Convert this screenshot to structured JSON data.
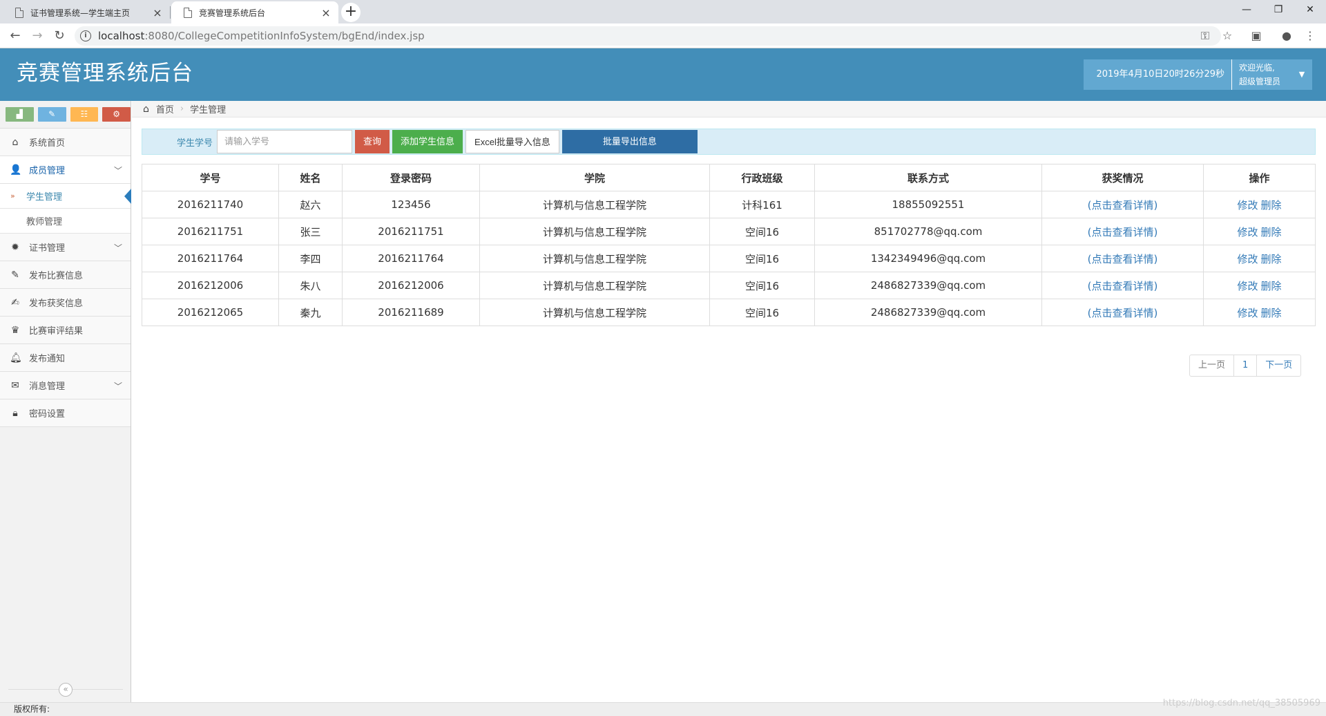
{
  "browser": {
    "tabs": [
      {
        "title": "证书管理系统—学生端主页",
        "close": "×"
      },
      {
        "title": "竞赛管理系统后台",
        "close": "×"
      }
    ],
    "new_tab": "+",
    "url_host": "localhost",
    "url_rest": ":8080/CollegeCompetitionInfoSystem/bgEnd/index.jsp",
    "controls": {
      "minimize": "—",
      "maximize": "❐",
      "close": "✕"
    }
  },
  "header": {
    "title": "竞赛管理系统后台",
    "datetime": "2019年4月10日20时26分29秒",
    "welcome": "欢迎光临,",
    "role": "超级管理员"
  },
  "sidebar": {
    "items": [
      {
        "label": "系统首页",
        "icon": "home-icon"
      },
      {
        "label": "成员管理",
        "icon": "users-icon",
        "open": true
      },
      {
        "label": "证书管理",
        "icon": "cog-icon"
      },
      {
        "label": "发布比赛信息",
        "icon": "pencil-icon"
      },
      {
        "label": "发布获奖信息",
        "icon": "edit-icon"
      },
      {
        "label": "比赛审评结果",
        "icon": "trophy-icon"
      },
      {
        "label": "发布通知",
        "icon": "bell-icon"
      },
      {
        "label": "消息管理",
        "icon": "envelope-icon"
      },
      {
        "label": "密码设置",
        "icon": "lock-icon"
      }
    ],
    "subitems": [
      {
        "label": "学生管理",
        "active": true
      },
      {
        "label": "教师管理"
      }
    ]
  },
  "breadcrumb": {
    "home": "首页",
    "current": "学生管理"
  },
  "search": {
    "label": "学生学号",
    "placeholder": "请输入学号",
    "query_btn": "查询",
    "add_btn": "添加学生信息",
    "import_btn": "Excel批量导入信息",
    "export_btn": "批量导出信息"
  },
  "table": {
    "headers": [
      "学号",
      "姓名",
      "登录密码",
      "学院",
      "行政班级",
      "联系方式",
      "获奖情况",
      "操作"
    ],
    "rows": [
      {
        "id": "2016211740",
        "name": "赵六",
        "password": "123456",
        "college": "计算机与信息工程学院",
        "class": "计科161",
        "contact": "18855092551",
        "award": "(点击查看详情)",
        "edit": "修改",
        "delete": "删除"
      },
      {
        "id": "2016211751",
        "name": "张三",
        "password": "2016211751",
        "college": "计算机与信息工程学院",
        "class": "空间16",
        "contact": "851702778@qq.com",
        "award": "(点击查看详情)",
        "edit": "修改",
        "delete": "删除"
      },
      {
        "id": "2016211764",
        "name": "李四",
        "password": "2016211764",
        "college": "计算机与信息工程学院",
        "class": "空间16",
        "contact": "1342349496@qq.com",
        "award": "(点击查看详情)",
        "edit": "修改",
        "delete": "删除"
      },
      {
        "id": "2016212006",
        "name": "朱八",
        "password": "2016212006",
        "college": "计算机与信息工程学院",
        "class": "空间16",
        "contact": "2486827339@qq.com",
        "award": "(点击查看详情)",
        "edit": "修改",
        "delete": "删除"
      },
      {
        "id": "2016212065",
        "name": "秦九",
        "password": "2016211689",
        "college": "计算机与信息工程学院",
        "class": "空间16",
        "contact": "2486827339@qq.com",
        "award": "(点击查看详情)",
        "edit": "修改",
        "delete": "删除"
      }
    ]
  },
  "pagination": {
    "prev": "上一页",
    "page": "1",
    "next": "下一页"
  },
  "footer": {
    "copyright": "版权所有:"
  },
  "watermark": "https://blog.csdn.net/qq_38505969",
  "colors": {
    "header_bg": "#438eb9",
    "accent": "#337ab7",
    "danger": "#d15b47",
    "success": "#4cae4c",
    "primary": "#2e6da4"
  }
}
